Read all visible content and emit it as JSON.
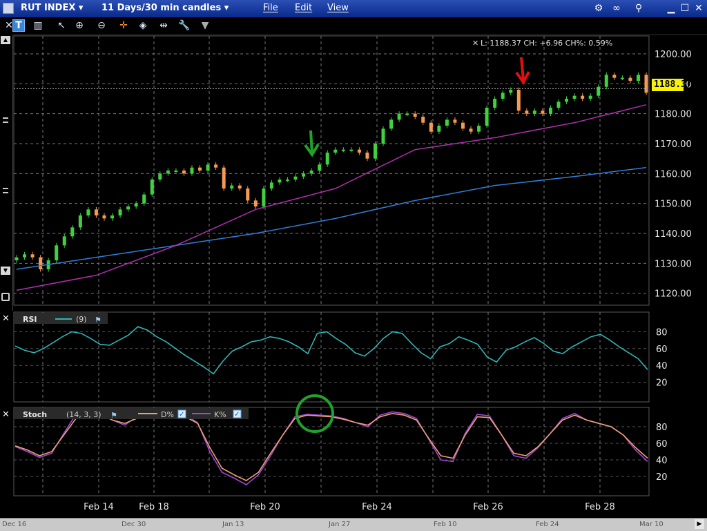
{
  "window": {
    "instrument": "RUT INDEX",
    "period": "11 Days/30 min candles",
    "menus": [
      "File",
      "Edit",
      "View"
    ],
    "title_controls": [
      "settings-icon",
      "link-icon",
      "pin-icon",
      "minimize-icon",
      "maximize-icon",
      "close-icon"
    ]
  },
  "toolbar": {
    "icons": [
      "t-button",
      "bar-style-icon",
      "cursor-icon",
      "zoom-in-icon",
      "zoom-out-icon",
      "crosshair-icon",
      "drawing-icon",
      "split-icon",
      "wrench-icon",
      "dropdown-icon"
    ],
    "t_label": "T"
  },
  "quote": {
    "text": "L: 1188.37 CH: +6.96 CH%: 0.59%",
    "last": "1188.37"
  },
  "price_axis": {
    "ticks": [
      "1200.00",
      "1190.00",
      "1180.00",
      "1170.00",
      "1160.00",
      "1150.00",
      "1140.00",
      "1130.00",
      "1120.00"
    ]
  },
  "rsi_panel": {
    "label": "RSI",
    "param": "(9)",
    "ticks": [
      "80",
      "60",
      "40",
      "20"
    ]
  },
  "stoch_panel": {
    "label": "Stoch",
    "param": "(14, 3, 3)",
    "d_label": "D%",
    "k_label": "K%",
    "ticks": [
      "80",
      "60",
      "40",
      "20"
    ]
  },
  "x_axis": {
    "labels": [
      "Feb 14",
      "Feb 18",
      "Feb 20",
      "Feb 24",
      "Feb 26",
      "Feb 28"
    ]
  },
  "scrollbar": {
    "labels": [
      "Dec 16",
      "Dec 30",
      "Jan 13",
      "Jan 27",
      "Feb 10",
      "Feb 24",
      "Mar 10"
    ]
  },
  "colors": {
    "up": "#3fd13f",
    "down": "#f59a52",
    "ma_short": "#b02fb0",
    "ma_long": "#2f7fd6",
    "rsi": "#2fb5b5",
    "stoch_k": "#9e49d8",
    "stoch_d": "#f0a070",
    "green_arrow": "#22a12a",
    "red_arrow": "#e01010",
    "highlight": "#f8f300"
  },
  "chart_data": {
    "type": "candlestick",
    "price_axis_range": [
      1116,
      1206
    ],
    "candles_approx_close": [
      1132,
      1133,
      1132,
      1128,
      1131,
      1136,
      1139,
      1142,
      1146,
      1148,
      1146,
      1145,
      1146,
      1148,
      1149,
      1150,
      1153,
      1158,
      1160,
      1161,
      1161,
      1160,
      1162,
      1161,
      1163,
      1162,
      1155,
      1156,
      1155,
      1151,
      1149,
      1155,
      1157,
      1158,
      1158,
      1159,
      1160,
      1161,
      1163,
      1167,
      1168,
      1168,
      1168,
      1167,
      1165,
      1170,
      1175,
      1178,
      1180,
      1180,
      1179,
      1177,
      1174,
      1176,
      1178,
      1177,
      1175,
      1174,
      1176,
      1182,
      1185,
      1187,
      1188,
      1181,
      1180,
      1181,
      1180,
      1182,
      1184,
      1185,
      1186,
      1185,
      1186,
      1189,
      1193,
      1192,
      1192,
      1191,
      1193,
      1187
    ],
    "moving_average_short_approx": [
      [
        0,
        1121
      ],
      [
        10,
        1126
      ],
      [
        20,
        1136
      ],
      [
        30,
        1148
      ],
      [
        40,
        1155
      ],
      [
        50,
        1168
      ],
      [
        60,
        1172
      ],
      [
        70,
        1177
      ],
      [
        79,
        1183
      ]
    ],
    "moving_average_long_approx": [
      [
        0,
        1128
      ],
      [
        10,
        1132
      ],
      [
        20,
        1136
      ],
      [
        30,
        1140
      ],
      [
        40,
        1145
      ],
      [
        50,
        1151
      ],
      [
        60,
        1156
      ],
      [
        70,
        1159
      ],
      [
        79,
        1162
      ]
    ],
    "rsi_approx": [
      63,
      58,
      55,
      60,
      67,
      74,
      80,
      78,
      72,
      65,
      64,
      70,
      76,
      86,
      82,
      74,
      68,
      60,
      52,
      45,
      38,
      30,
      45,
      57,
      62,
      68,
      70,
      74,
      72,
      68,
      62,
      54,
      78,
      80,
      72,
      65,
      55,
      51,
      60,
      72,
      80,
      78,
      66,
      55,
      48,
      62,
      66,
      74,
      70,
      65,
      50,
      44,
      58,
      62,
      68,
      73,
      66,
      57,
      54,
      62,
      68,
      74,
      77,
      70,
      62,
      55,
      48,
      35
    ],
    "stoch_k_approx": [
      56,
      50,
      43,
      48,
      72,
      95,
      98,
      96,
      88,
      82,
      92,
      96,
      97,
      96,
      94,
      85,
      50,
      25,
      18,
      10,
      22,
      45,
      70,
      92,
      95,
      94,
      93,
      90,
      85,
      80,
      94,
      98,
      96,
      90,
      65,
      40,
      38,
      72,
      95,
      93,
      70,
      45,
      42,
      55,
      72,
      90,
      96,
      88,
      84,
      80,
      70,
      52,
      38
    ],
    "stoch_d_approx": [
      57,
      52,
      45,
      50,
      70,
      90,
      96,
      95,
      88,
      84,
      90,
      94,
      95,
      95,
      92,
      84,
      55,
      30,
      22,
      15,
      25,
      48,
      70,
      90,
      94,
      93,
      92,
      89,
      85,
      82,
      92,
      96,
      94,
      88,
      66,
      45,
      42,
      70,
      92,
      91,
      70,
      48,
      45,
      56,
      72,
      88,
      94,
      88,
      84,
      80,
      70,
      55,
      42
    ],
    "annotations": [
      "green-down-arrow-near-Feb-21",
      "red-down-arrow-near-Feb-26",
      "green-circle-on-stoch-peak"
    ]
  }
}
